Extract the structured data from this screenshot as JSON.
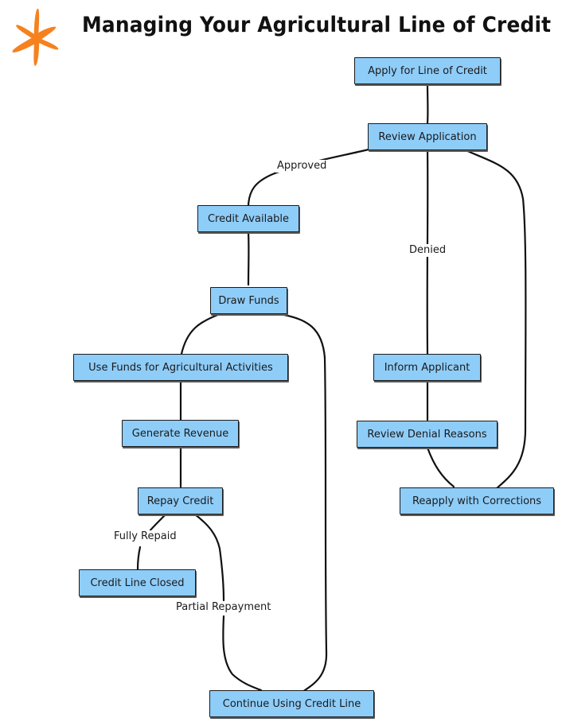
{
  "title": "Managing Your Agricultural Line of Credit",
  "logo_icon": "orange-star-icon",
  "colors": {
    "node_fill": "#8fcdf9",
    "node_border": "#1a1a1a",
    "logo": "#f5821f",
    "edge": "#111111"
  },
  "nodes": {
    "apply": "Apply for Line of Credit",
    "review": "Review Application",
    "credit_available": "Credit Available",
    "draw_funds": "Draw Funds",
    "use_funds": "Use Funds for Agricultural Activities",
    "generate_revenue": "Generate Revenue",
    "repay_credit": "Repay Credit",
    "credit_line_closed": "Credit Line Closed",
    "continue_using": "Continue Using Credit Line",
    "inform_applicant": "Inform Applicant",
    "review_denial": "Review Denial Reasons",
    "reapply": "Reapply with Corrections"
  },
  "edge_labels": {
    "approved": "Approved",
    "denied": "Denied",
    "fully_repaid": "Fully Repaid",
    "partial_repayment": "Partial Repayment"
  },
  "edges": [
    {
      "from": "apply",
      "to": "review",
      "label": ""
    },
    {
      "from": "review",
      "to": "credit_available",
      "label": "Approved"
    },
    {
      "from": "review",
      "to": "inform_applicant",
      "label": "Denied"
    },
    {
      "from": "credit_available",
      "to": "draw_funds",
      "label": ""
    },
    {
      "from": "draw_funds",
      "to": "use_funds",
      "label": ""
    },
    {
      "from": "use_funds",
      "to": "generate_revenue",
      "label": ""
    },
    {
      "from": "generate_revenue",
      "to": "repay_credit",
      "label": ""
    },
    {
      "from": "repay_credit",
      "to": "credit_line_closed",
      "label": "Fully Repaid"
    },
    {
      "from": "repay_credit",
      "to": "continue_using",
      "label": "Partial Repayment"
    },
    {
      "from": "continue_using",
      "to": "draw_funds",
      "label": ""
    },
    {
      "from": "inform_applicant",
      "to": "review_denial",
      "label": ""
    },
    {
      "from": "review_denial",
      "to": "reapply",
      "label": ""
    },
    {
      "from": "reapply",
      "to": "review",
      "label": ""
    }
  ]
}
